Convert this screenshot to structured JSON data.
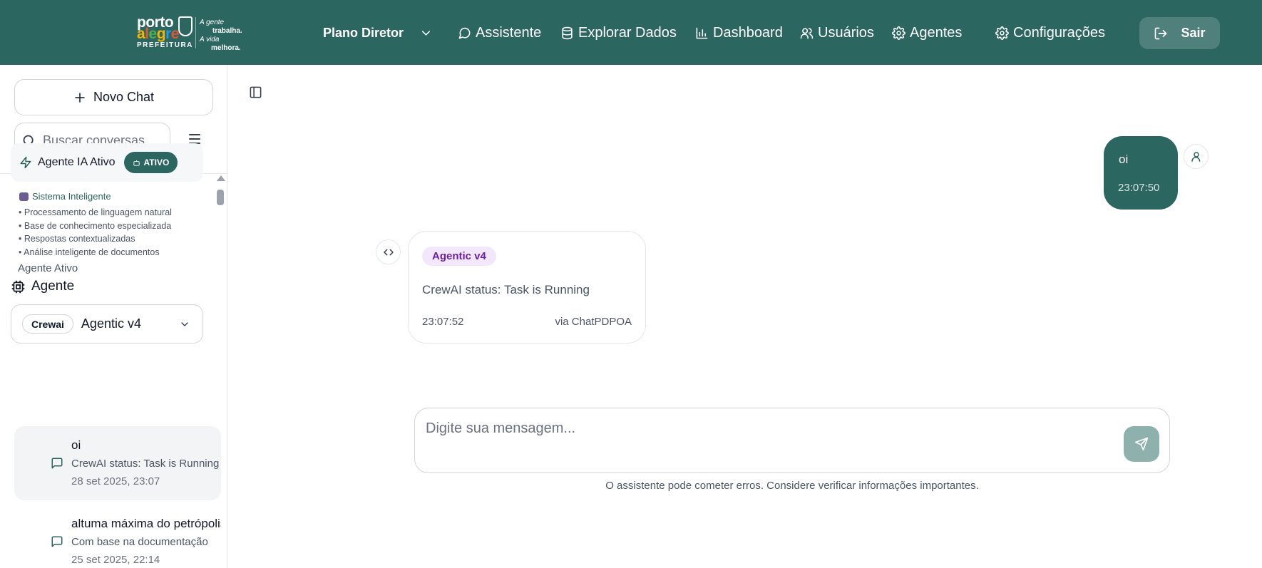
{
  "brand": {
    "line1": "porto",
    "line2": "alegre",
    "line3": "PREFEITURA",
    "slogan": [
      "A gente",
      "trabalha.",
      "A vida",
      "melhora."
    ]
  },
  "nav": {
    "plano": "Plano Diretor",
    "assistente": "Assistente",
    "explorar": "Explorar Dados",
    "dashboard": "Dashboard",
    "usuarios": "Usuários",
    "agentes": "Agentes",
    "configuracoes": "Configurações",
    "sair": "Sair"
  },
  "sidebar": {
    "new_chat": "Novo Chat",
    "search_placeholder": "Buscar conversas...",
    "agent_card": {
      "title": "Agente IA Ativo",
      "badge": "ATIVO"
    },
    "system": {
      "title": "Sistema Inteligente",
      "features": [
        "Processamento de linguagem natural",
        "Base de conhecimento especializada",
        "Respostas contextualizadas",
        "Análise inteligente de documentos"
      ]
    },
    "agente_ativo_label": "Agente Ativo",
    "agente_label": "Agente",
    "agent_select": {
      "pill": "Crewai",
      "value": "Agentic v4"
    },
    "conversations": [
      {
        "title": "oi",
        "preview": "CrewAI status: Task is Running",
        "date": "28 set 2025, 23:07"
      },
      {
        "title": "altuma máxima do petrópolis",
        "preview": "Com base na documentação",
        "date": "25 set 2025, 22:14"
      }
    ]
  },
  "chat": {
    "user_message": {
      "text": "oi",
      "time": "23:07:50"
    },
    "bot_message": {
      "tag": "Agentic v4",
      "text": "CrewAI status: Task is Running",
      "time": "23:07:52",
      "via": "via ChatPDPOA"
    },
    "input_placeholder": "Digite sua mensagem...",
    "disclaimer": "O assistente pode cometer erros. Considere verificar informações importantes."
  },
  "colors": {
    "header_bg": "#2c6661",
    "accent": "#2c6661",
    "tag_bg": "#f3e8fb",
    "tag_text": "#6b21a8",
    "send_bg": "#8fb1ae"
  },
  "icons": {
    "assistente": "message-circle-icon",
    "explorar": "database-icon",
    "dashboard": "bar-chart-icon",
    "usuarios": "users-icon",
    "agentes": "gear-icon",
    "configuracoes": "gear-icon",
    "sair": "log-out-icon"
  }
}
